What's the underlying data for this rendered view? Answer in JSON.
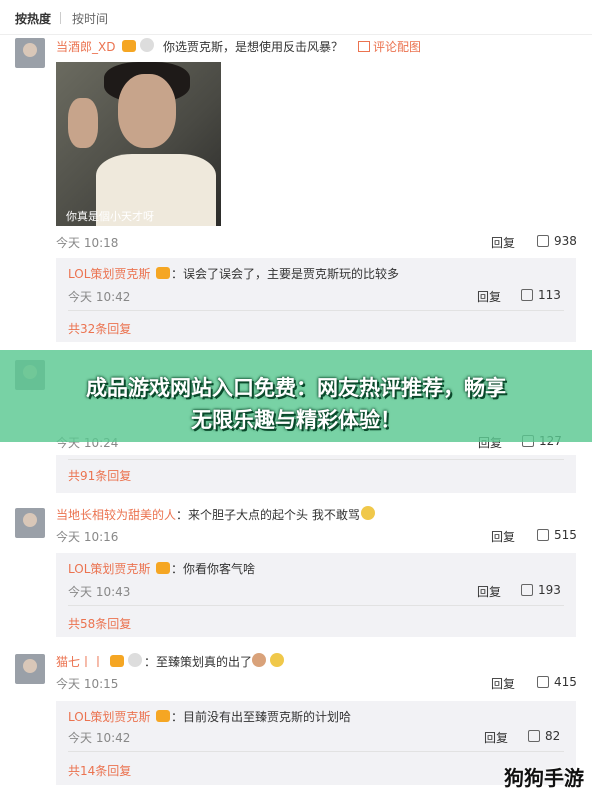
{
  "sort": {
    "hot": "按热度",
    "time": "按时间"
  },
  "comments": [
    {
      "user": "当酒郎_XD",
      "text": "你选贾克斯，是想使用反击风暴？",
      "action": "评论配图",
      "image_caption": "你真是個小天才呀",
      "time": "今天 10:18",
      "reply": "回复",
      "likes": "938",
      "sub": {
        "user": "LOL策划贾克斯",
        "text": "：误会了误会了，主要是贾克斯玩的比较多",
        "time": "今天 10:42",
        "reply": "回复",
        "likes": "113",
        "total": "共32条回复"
      }
    },
    {
      "user": "",
      "text": "",
      "time": "今天 10:24",
      "reply": "回复",
      "likes": "127",
      "sub": {
        "total": "共91条回复"
      }
    },
    {
      "user": "当地长相较为甜美的人",
      "text": "：来个胆子大点的起个头 我不敢骂",
      "time": "今天 10:16",
      "reply": "回复",
      "likes": "515",
      "sub": {
        "user": "LOL策划贾克斯",
        "text": "：你看你客气啥",
        "time": "今天 10:43",
        "reply": "回复",
        "likes": "193",
        "total": "共58条回复"
      }
    },
    {
      "user": "猫七丨丨",
      "text": "：至臻策划真的出了",
      "time": "今天 10:15",
      "reply": "回复",
      "likes": "415",
      "sub": {
        "user": "LOL策划贾克斯",
        "text": "：目前没有出至臻贾克斯的计划哈",
        "time": "今天 10:42",
        "reply": "回复",
        "likes": "82",
        "total": "共14条回复"
      }
    }
  ],
  "banner": {
    "line1": "成品游戏网站入口免费：网友热评推荐，畅享",
    "line2": "无限乐趣与精彩体验！"
  },
  "watermark": "狗狗手游",
  "colors": {
    "username": "#eb7350",
    "banner": "#5ac891",
    "sub_bg": "#f2f2f5"
  }
}
